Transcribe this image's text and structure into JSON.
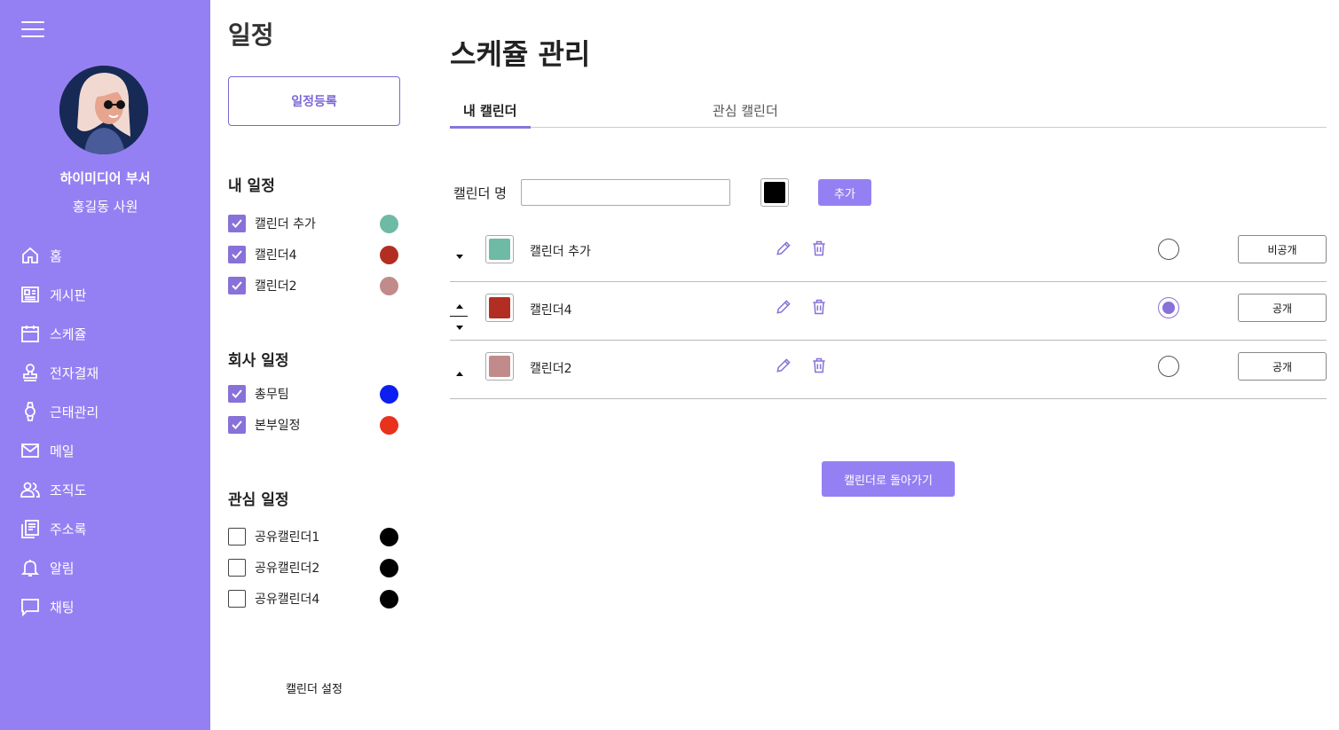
{
  "sidebar": {
    "department": "하이미디어 부서",
    "user_name": "홍길동 사원",
    "items": [
      {
        "label": "홈",
        "icon": "home-icon"
      },
      {
        "label": "게시판",
        "icon": "board-icon"
      },
      {
        "label": "스케쥴",
        "icon": "calendar-icon"
      },
      {
        "label": "전자결재",
        "icon": "stamp-icon"
      },
      {
        "label": "근태관리",
        "icon": "watch-icon"
      },
      {
        "label": "메일",
        "icon": "mail-icon"
      },
      {
        "label": "조직도",
        "icon": "people-icon"
      },
      {
        "label": "주소록",
        "icon": "address-book-icon"
      },
      {
        "label": "알림",
        "icon": "bell-icon"
      },
      {
        "label": "채팅",
        "icon": "chat-icon"
      }
    ],
    "bg_color": "#9580f3"
  },
  "schedule_panel": {
    "title": "일정",
    "register_button": "일정등록",
    "my_title": "내 일정",
    "my_calendars": [
      {
        "label": "캘린더 추가",
        "checked": true,
        "color": "#6fbaa5"
      },
      {
        "label": "캘린더4",
        "checked": true,
        "color": "#b32e22"
      },
      {
        "label": "캘린더2",
        "checked": true,
        "color": "#c18b8b"
      }
    ],
    "company_title": "회사 일정",
    "company_calendars": [
      {
        "label": "총무팀",
        "checked": true,
        "color": "#0c1ff0"
      },
      {
        "label": "본부일정",
        "checked": true,
        "color": "#e8321c"
      }
    ],
    "interest_title": "관심 일정",
    "interest_calendars": [
      {
        "label": "공유캘린더1",
        "checked": false,
        "color": "#000000"
      },
      {
        "label": "공유캘린더2",
        "checked": false,
        "color": "#000000"
      },
      {
        "label": "공유캘린더4",
        "checked": false,
        "color": "#000000"
      }
    ],
    "settings_link": "캘린더 설정"
  },
  "main": {
    "title": "스케쥴 관리",
    "tabs": [
      {
        "label": "내 캘린더",
        "active": true
      },
      {
        "label": "관심 캘린더",
        "active": false
      }
    ],
    "name_label": "캘린더 명",
    "name_input_value": "",
    "new_color": "#000000",
    "add_button": "추가",
    "calendars": [
      {
        "name": "캘린더 추가",
        "color": "#6fbaa5",
        "default": false,
        "visibility": "비공개"
      },
      {
        "name": "캘린더4",
        "color": "#b32e22",
        "default": true,
        "visibility": "공개"
      },
      {
        "name": "캘린더2",
        "color": "#c18b8b",
        "default": false,
        "visibility": "공개"
      }
    ],
    "back_button": "캘린더로 돌아가기",
    "accent_color": "#8871d8"
  }
}
